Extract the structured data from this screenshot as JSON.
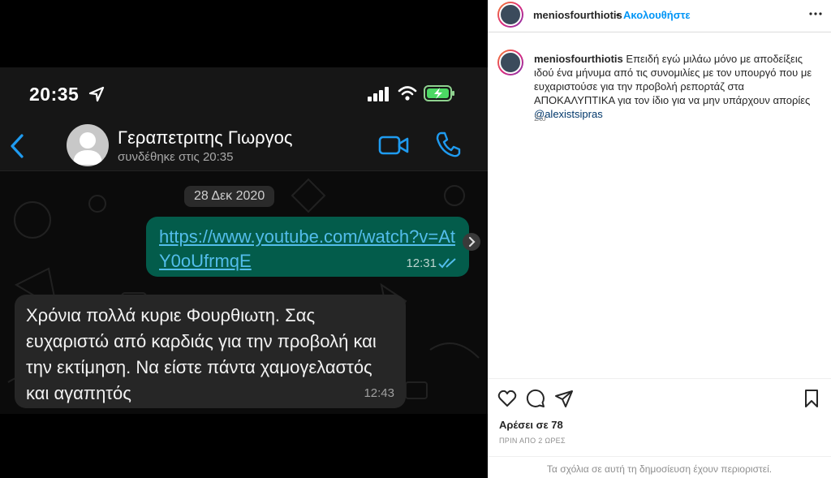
{
  "post_image": {
    "status_bar": {
      "time": "20:35"
    },
    "chat_header": {
      "contact_name": "Γεραπετριτης Γιωργος",
      "last_seen": "συνδέθηκε στις 20:35"
    },
    "date_chip": "28 Δεκ 2020",
    "messages": [
      {
        "direction": "outgoing",
        "text": "https://www.youtube.com/watch?v=AtY0oUfrmqE",
        "time": "12:31"
      },
      {
        "direction": "incoming",
        "text": "Χρόνια πολλά κυριε Φουρθιωτη. Σας ευχαριστώ από καρδιάς για την προβολή και την εκτίμηση. Να είστε πάντα χαμογελαστός και αγαπητός",
        "time": "12:43"
      }
    ],
    "colors": {
      "outgoing_bubble": "#035c4b",
      "incoming_bubble": "#262626",
      "link": "#53bdeb",
      "accent_icon": "#1f9bf0"
    }
  },
  "post_header": {
    "username": "meniosfourthiotis",
    "separator": "•",
    "follow_label": "Ακολουθήστε",
    "more_icon": "more-horizontal-icon"
  },
  "caption": {
    "username": "meniosfourthiotis",
    "text": "Επειδή εγώ μιλάω μόνο με αποδείξεις ιδού ένα μήνυμα από τις συνομιλίες με τον υπουργό που με ευχαριστούσε για την προβολή ρεπορτάζ στα ΑΠΟΚΑΛΥΠΤΙΚΑ για τον ίδιο για να μην υπάρχουν απορίες",
    "mention": "@alexistsipras",
    "age": "2ω"
  },
  "actions": {
    "icons": [
      "heart-icon",
      "comment-icon",
      "share-icon",
      "bookmark-icon"
    ],
    "likes_label": "Αρέσει σε 78",
    "timestamp": "ΠΡΙΝ ΑΠΟ 2 ΩΡΕΣ",
    "comments_limited": "Τα σχόλια σε αυτή τη δημοσίευση έχουν περιοριστεί.",
    "colors": {
      "follow": "#0095f6",
      "mention": "#00376b",
      "muted": "#8e8e8e"
    }
  }
}
